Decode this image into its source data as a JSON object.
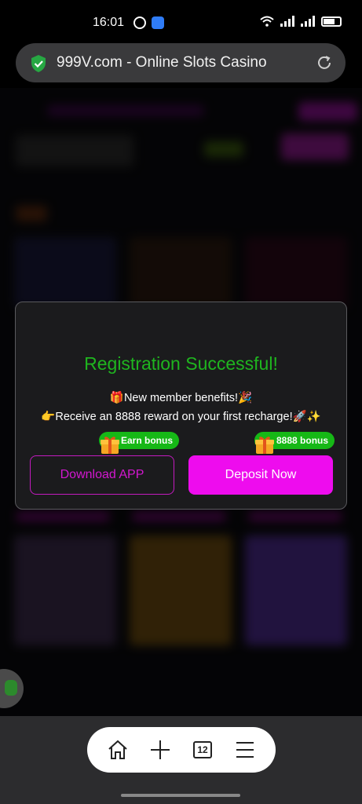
{
  "status_bar": {
    "time": "16:01"
  },
  "browser": {
    "url_text": "999V.com - Online Slots Casino",
    "tabs_count": "12"
  },
  "modal": {
    "title": "Registration Successful!",
    "line1": "🎁New member benefits!🎉",
    "line2": "👉Receive an 8888 reward on your first recharge!🚀✨",
    "download_label": "Download APP",
    "deposit_label": "Deposit Now",
    "earn_badge": "Earn bonus",
    "bonus_badge": "8888 bonus"
  },
  "icons": {
    "secure": "shield-check-icon",
    "refresh": "refresh-icon",
    "home": "home-icon",
    "new_tab": "plus-icon",
    "menu": "hamburger-menu-icon",
    "gift": "gift-icon",
    "chat": "chat-icon"
  },
  "colors": {
    "accent": "#ee0cee",
    "success": "#1fb51f",
    "badge_green": "#16b816",
    "modal_bg": "#1b1b1d"
  }
}
